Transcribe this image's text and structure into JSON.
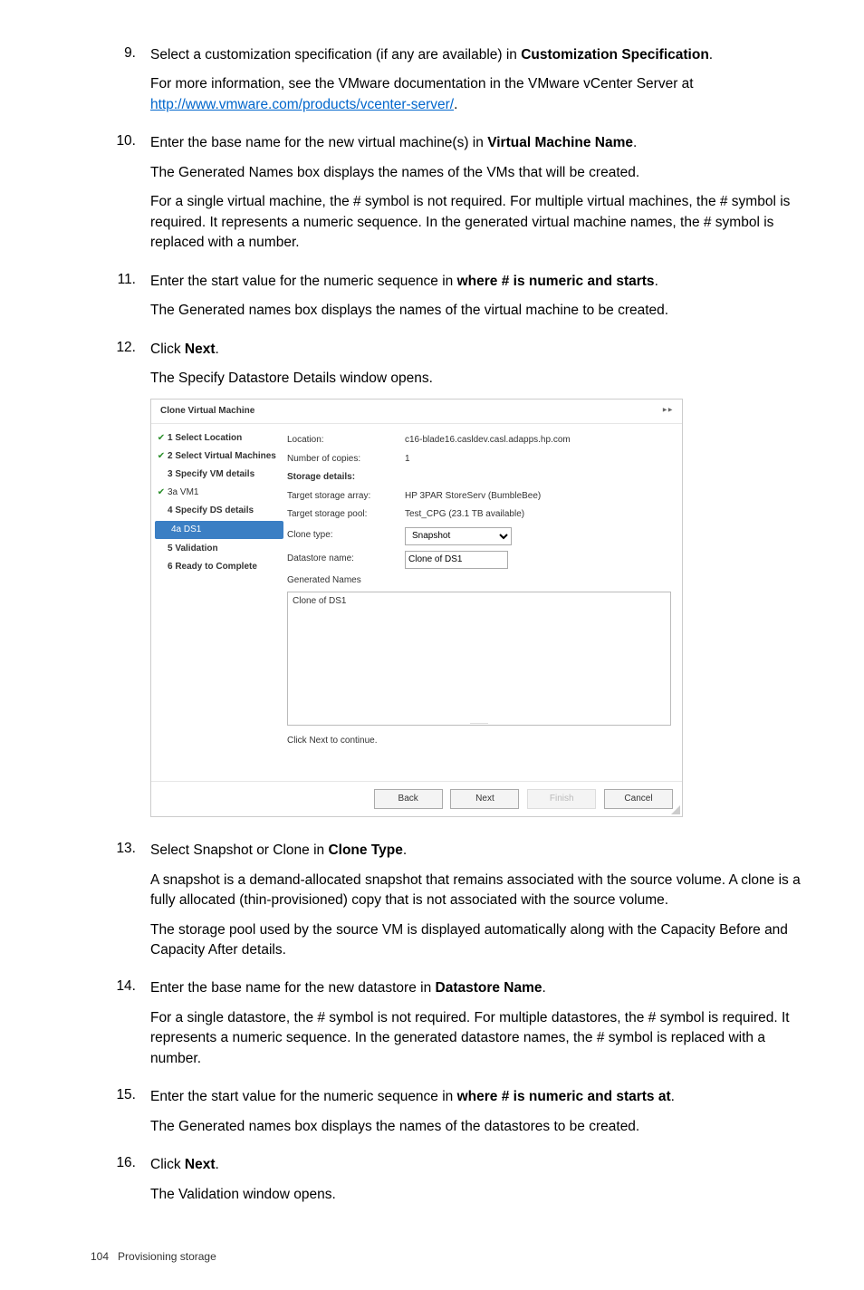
{
  "steps": {
    "s9": {
      "num": "9.",
      "p1a": "Select a customization specification (if any are available) in ",
      "p1b": "Customization Specification",
      "p1c": ".",
      "p2a": "For more information, see the VMware documentation in the VMware vCenter Server at ",
      "link": "http://www.vmware.com/products/vcenter-server/",
      "p2b": "."
    },
    "s10": {
      "num": "10.",
      "p1a": "Enter the base name for the new virtual machine(s) in ",
      "p1b": "Virtual Machine Name",
      "p1c": ".",
      "p2": "The Generated Names box displays the names of the VMs that will be created.",
      "p3": "For a single virtual machine, the # symbol is not required. For multiple virtual machines, the # symbol is required. It represents a numeric sequence. In the generated virtual machine names, the # symbol is replaced with a number."
    },
    "s11": {
      "num": "11.",
      "p1a": "Enter the start value for the numeric sequence in ",
      "p1b": "where # is numeric and starts",
      "p1c": ".",
      "p2": "The Generated names box displays the names of the virtual machine to be created."
    },
    "s12": {
      "num": "12.",
      "p1a": "Click ",
      "p1b": "Next",
      "p1c": ".",
      "p2": "The Specify Datastore Details window opens."
    },
    "s13": {
      "num": "13.",
      "p1a": "Select Snapshot or Clone in ",
      "p1b": "Clone Type",
      "p1c": ".",
      "p2": "A snapshot is a demand-allocated snapshot that remains associated with the source volume. A clone is a fully allocated (thin-provisioned) copy that is not associated with the source volume.",
      "p3": "The storage pool used by the source VM is displayed automatically along with the Capacity Before and Capacity After details."
    },
    "s14": {
      "num": "14.",
      "p1a": "Enter the base name for the new datastore in ",
      "p1b": "Datastore Name",
      "p1c": ".",
      "p2": "For a single datastore, the # symbol is not required. For multiple datastores, the # symbol is required. It represents a numeric sequence. In the generated datastore names, the # symbol is replaced with a number."
    },
    "s15": {
      "num": "15.",
      "p1a": "Enter the start value for the numeric sequence in ",
      "p1b": "where # is numeric and starts at",
      "p1c": ".",
      "p2": "The Generated names box displays the names of the datastores to be created."
    },
    "s16": {
      "num": "16.",
      "p1a": "Click ",
      "p1b": "Next",
      "p1c": ".",
      "p2": "The Validation window opens."
    }
  },
  "dialog": {
    "title": "Clone Virtual Machine",
    "close": "▸▸",
    "nav": {
      "i1": "1  Select Location",
      "i2": "2  Select Virtual Machines",
      "i3": "3  Specify VM details",
      "i3a": "3a VM1",
      "i4": "4  Specify DS details",
      "i4a": "4a DS1",
      "i5": "5  Validation",
      "i6": "6  Ready to Complete"
    },
    "fields": {
      "location_l": "Location:",
      "location_v": "c16-blade16.casldev.casl.adapps.hp.com",
      "copies_l": "Number of copies:",
      "copies_v": "1",
      "storage_l": "Storage details:",
      "array_l": "Target storage array:",
      "array_v": "HP 3PAR StoreServ (BumbleBee)",
      "pool_l": "Target storage pool:",
      "pool_v": "Test_CPG (23.1 TB available)",
      "ctype_l": "Clone type:",
      "ctype_v": "Snapshot",
      "dsname_l": "Datastore name:",
      "dsname_v": "Clone of DS1",
      "gen_l": "Generated Names",
      "gen_v": "Clone of DS1",
      "hint": "Click Next to continue."
    },
    "buttons": {
      "back": "Back",
      "next": "Next",
      "finish": "Finish",
      "cancel": "Cancel"
    }
  },
  "footer": {
    "page": "104",
    "section": "Provisioning storage"
  }
}
